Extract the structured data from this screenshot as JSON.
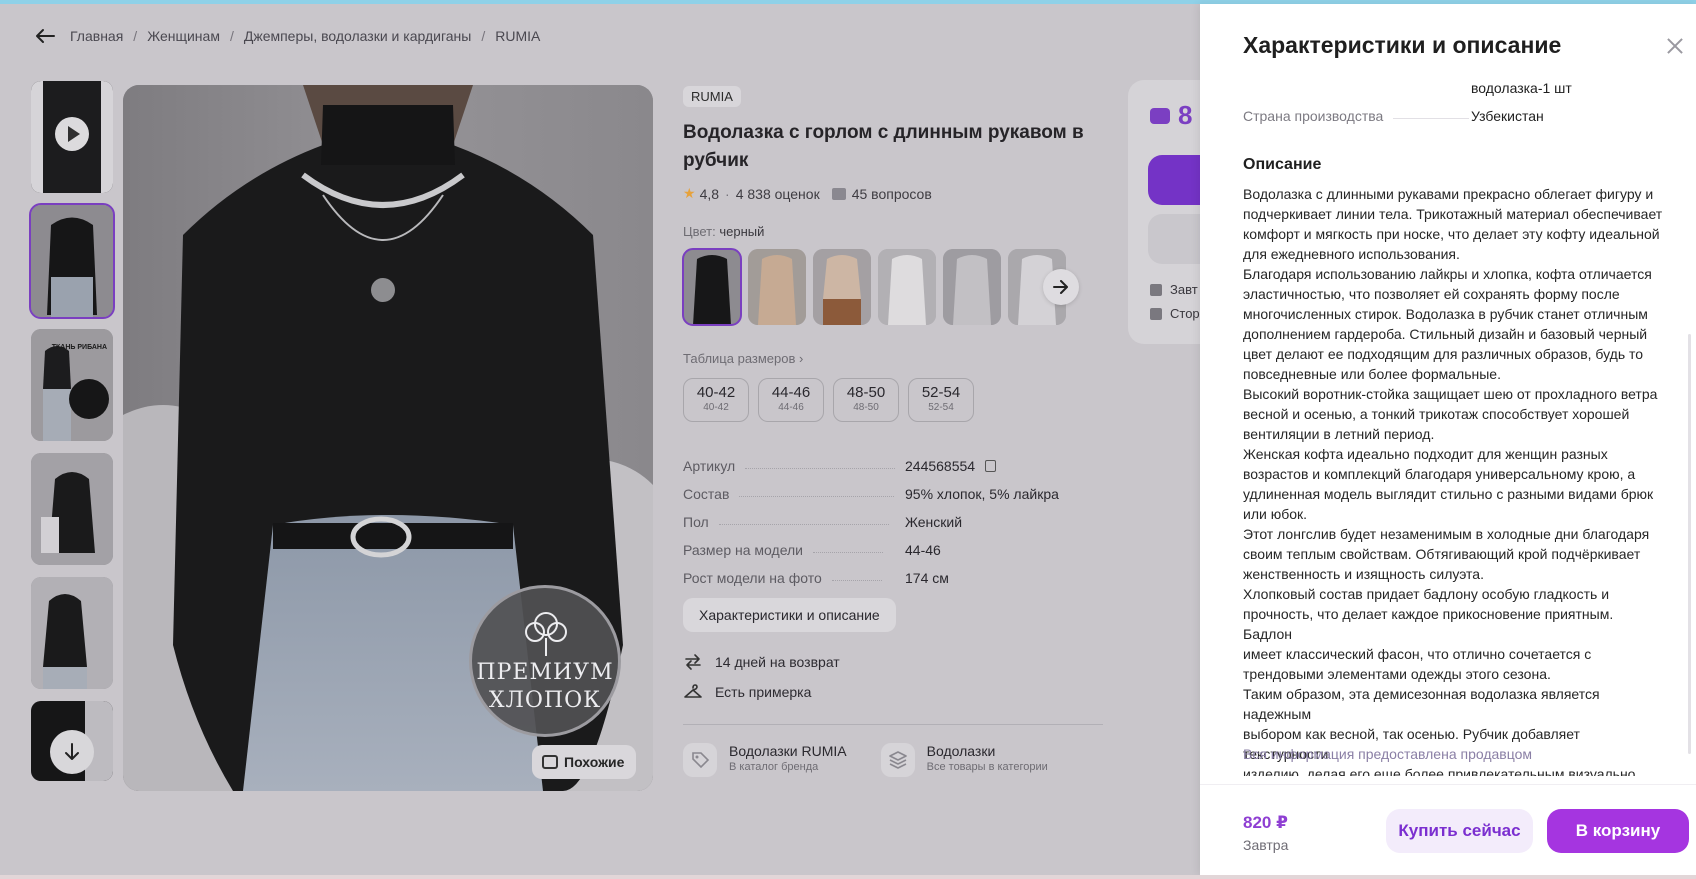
{
  "breadcrumb": {
    "items": [
      "Главная",
      "Женщинам",
      "Джемперы, водолазки и кардиганы",
      "RUMIA"
    ],
    "sep": "/"
  },
  "gallery": {
    "thumb_text": "ТКАНЬ РИБАНА",
    "badge_line1": "ПРЕМИУМ",
    "badge_line2": "ХЛОПОК",
    "similar_label": "Похожие"
  },
  "product": {
    "brand": "RUMIA",
    "title": "Водолазка с горлом с длинным рукавом в рубчик",
    "rating": "4,8",
    "reviews": "4 838 оценок",
    "questions": "45 вопросов",
    "color_label": "Цвет:",
    "color_value": "черный",
    "size_table_label": "Таблица размеров",
    "sizes": [
      {
        "main": "40-42",
        "sub": "40-42"
      },
      {
        "main": "44-46",
        "sub": "44-46"
      },
      {
        "main": "48-50",
        "sub": "48-50"
      },
      {
        "main": "52-54",
        "sub": "52-54"
      }
    ],
    "specs": [
      {
        "key": "Артикул",
        "value": "244568554"
      },
      {
        "key": "Состав",
        "value": "95% хлопок, 5% лайкра"
      },
      {
        "key": "Пол",
        "value": "Женский"
      },
      {
        "key": "Размер на модели",
        "value": "44-46"
      },
      {
        "key": "Рост модели на фото",
        "value": "174 см"
      }
    ],
    "char_button": "Характеристики и описание",
    "features": [
      "14 дней на возврат",
      "Есть примерка"
    ],
    "links": [
      {
        "title": "Водолазки RUMIA",
        "sub": "В каталог бренда"
      },
      {
        "title": "Водолазки",
        "sub": "Все товары в категории"
      }
    ]
  },
  "price_card": {
    "price_partial": "8",
    "row1": "Завт",
    "row2": "Стор"
  },
  "panel": {
    "title": "Характеристики и описание",
    "cont_value": "водолазка-1 шт",
    "country_key": "Страна производства",
    "country_value": "Узбекистан",
    "desc_title": "Описание",
    "desc_lines": [
      "Водолазка с длинными рукавами прекрасно облегает фигуру и",
      "подчеркивает линии тела. Трикотажный материал обеспечивает",
      "комфорт и мягкость при носке, что делает эту кофту идеальной",
      "для ежедневного использования.",
      "Благодаря использованию лайкры и хлопка, кофта отличается",
      "эластичностью, что позволяет ей сохранять форму после",
      "многочисленных стирок. Водолазка в рубчик станет отличным",
      "дополнением гардероба. Стильный дизайн и базовый черный",
      "цвет делают ее подходящим для различных образов, будь то",
      "повседневные или более формальные.",
      "Высокий воротник-стойка защищает шею от прохладного ветра",
      "весной и осенью, а тонкий трикотаж способствует хорошей",
      "вентиляции в летний период.",
      "Женская кофта идеально подходит для женщин разных",
      "возрастов и комплекций благодаря универсальному крою, а",
      "удлиненная модель выглядит стильно с разными видами брюк",
      "или юбок.",
      "Этот лонгслив будет незаменимым в холодные дни благодаря",
      "своим теплым свойствам. Обтягивающий крой подчёркивает",
      "женственность и изящность силуэта.",
      "Хлопковый состав придает бадлону особую гладкость и",
      "прочность, что делает каждое прикосновение приятным. Бадлон",
      "имеет классический фасон, что отлично сочетается с",
      "трендовыми элементами одежды этого сезона.",
      "Таким образом, эта демисезонная водолазка является надежным",
      "выбором как весной, так осенью. Рубчик добавляет текстурности",
      "изделию, делая его еще более привлекательным визуально."
    ],
    "source": "Вся информация предоставлена продавцом",
    "footer_price": "820 ₽",
    "footer_date": "Завтра",
    "buy_now": "Купить сейчас",
    "to_cart": "В корзину"
  }
}
